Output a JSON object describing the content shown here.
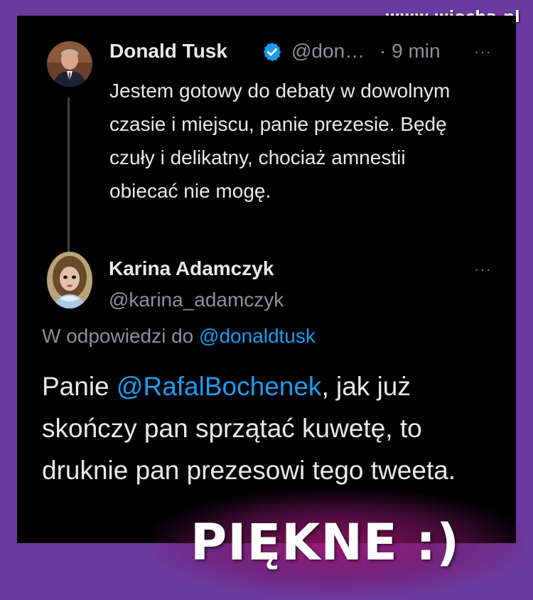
{
  "watermark": "www.wiocha.pl",
  "tweet1": {
    "author": "Donald Tusk",
    "handle": "@don…",
    "time": "· 9 min",
    "more": "···",
    "text": "Jestem gotowy do debaty w dowolnym czasie i miejscu, panie prezesie. Będę czuły i delikatny, chociaż amnestii obiecać nie mogę."
  },
  "tweet2": {
    "author": "Karina Adamczyk",
    "handle": "@karina_adamczyk",
    "more": "···",
    "reply_prefix": "W odpowiedzi do ",
    "reply_mention": "@donaldtusk",
    "text_before": "Panie ",
    "text_mention": "@RafalBochenek",
    "text_after": ", jak już skończy pan sprzątać kuwetę, to druknie pan prezesowi tego tweeta."
  },
  "badge": "PIĘKNE :)",
  "colors": {
    "background": "#6b3a9e",
    "panel": "#000000",
    "link": "#1d9bf0",
    "verified": "#1d9bf0"
  }
}
